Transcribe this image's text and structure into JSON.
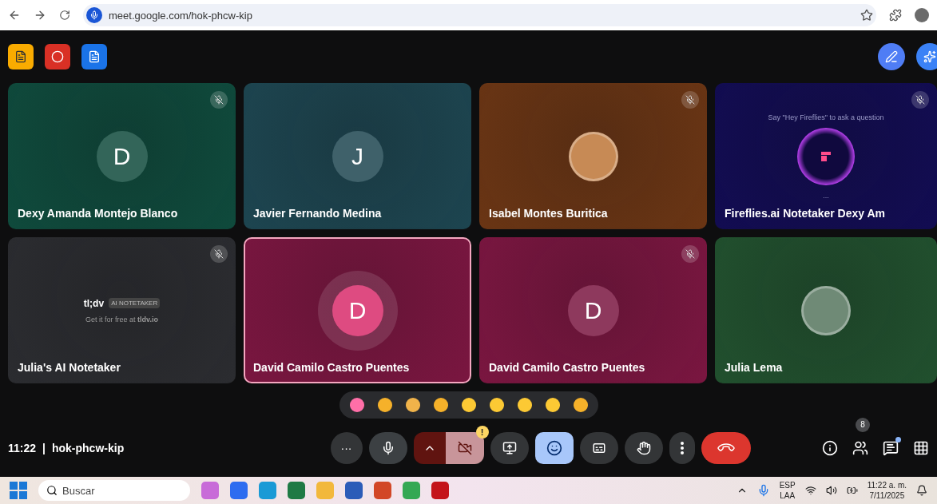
{
  "browser": {
    "url": "meet.google.com/hok-phcw-kip"
  },
  "tiles": [
    {
      "name": "Dexy Amanda Montejo Blanco",
      "color": "#0f4a3c",
      "kind": "letter",
      "initial": "D",
      "muted": true,
      "selected": false
    },
    {
      "name": "Javier Fernando Medina",
      "color": "#1d4550",
      "kind": "letter",
      "initial": "J",
      "muted": false,
      "selected": false
    },
    {
      "name": "Isabel Montes Buritica",
      "color": "#6a3514",
      "kind": "photo",
      "muted": true,
      "selected": false
    },
    {
      "name": "Fireflies.ai Notetaker Dexy Am",
      "color": "#120c52",
      "kind": "fireflies",
      "caption": "Say \"Hey Fireflies\" to ask a question",
      "dots": "...",
      "muted": true,
      "selected": false
    },
    {
      "name": "Julia's AI Notetaker",
      "color": "#2b2c30",
      "kind": "tldv",
      "logo": "tl;dv",
      "tag": "AI NOTETAKER",
      "caption": "Get it for free at **tldv.io**",
      "muted": true,
      "selected": false
    },
    {
      "name": "David Camilo Castro Puentes",
      "color": "#7a1640",
      "kind": "letter",
      "initial": "D",
      "muted": false,
      "selected": true
    },
    {
      "name": "David Camilo Castro Puentes",
      "color": "#7a1640",
      "kind": "letter",
      "initial": "D",
      "muted": true,
      "selected": false
    },
    {
      "name": "Julia Lema",
      "color": "#21502e",
      "kind": "photo",
      "muted": false,
      "selected": false
    }
  ],
  "meeting": {
    "time": "11:22",
    "separator": "|",
    "code": "hok-phcw-kip"
  },
  "controls": [
    {
      "kind": "more-options",
      "label": "···"
    },
    {
      "kind": "mic",
      "on": true
    },
    {
      "kind": "camera",
      "on": false,
      "alert": "!"
    },
    {
      "kind": "present"
    },
    {
      "kind": "reactions",
      "selected": true
    },
    {
      "kind": "captions",
      "selected": false
    },
    {
      "kind": "hand",
      "selected": false
    },
    {
      "kind": "more"
    },
    {
      "kind": "leave"
    }
  ],
  "people_count": "8",
  "taskbar": {
    "search_placeholder": "Buscar",
    "language": "ESP",
    "layout": "LAA",
    "time": "11:22 a. m.",
    "date": "7/11/2025"
  }
}
